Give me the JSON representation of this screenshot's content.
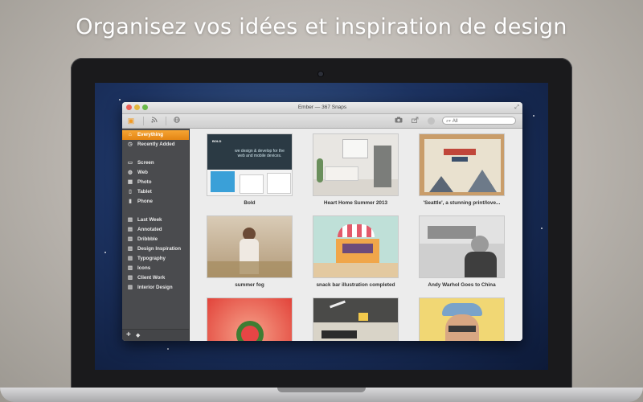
{
  "headline": "Organisez vos idées et inspiration de design",
  "window": {
    "title": "Ember — 367 Snaps"
  },
  "toolbar": {
    "search_placeholder": "All"
  },
  "sidebar": {
    "items": [
      {
        "label": "Everything",
        "icon": "home-icon",
        "active": true
      },
      {
        "label": "Recently Added",
        "icon": "clock-icon"
      },
      {
        "label": "Screen",
        "icon": "monitor-icon"
      },
      {
        "label": "Web",
        "icon": "globe-icon"
      },
      {
        "label": "Photo",
        "icon": "photo-icon"
      },
      {
        "label": "Tablet",
        "icon": "tablet-icon"
      },
      {
        "label": "Phone",
        "icon": "phone-icon"
      },
      {
        "label": "Last Week",
        "icon": "calendar-icon"
      },
      {
        "label": "Annotated",
        "icon": "annotation-icon"
      },
      {
        "label": "Dribbble",
        "icon": "document-icon"
      },
      {
        "label": "Design Inspiration",
        "icon": "document-icon"
      },
      {
        "label": "Typography",
        "icon": "document-icon"
      },
      {
        "label": "Icons",
        "icon": "document-icon"
      },
      {
        "label": "Client Work",
        "icon": "document-icon"
      },
      {
        "label": "Interior Design",
        "icon": "document-icon"
      }
    ]
  },
  "snaps": [
    {
      "caption": "Bold"
    },
    {
      "caption": "Heart Home Summer 2013"
    },
    {
      "caption": "'Seattle', a stunning print/love..."
    },
    {
      "caption": "summer fog"
    },
    {
      "caption": "snack bar illustration completed"
    },
    {
      "caption": "Andy Warhol Goes to China"
    },
    {
      "caption": ""
    },
    {
      "caption": ""
    },
    {
      "caption": ""
    }
  ],
  "bold_thumb": {
    "logo": "BOLD",
    "tagline": "we design & develop for the web and mobile devices."
  },
  "colors": {
    "accent": "#f29a22",
    "sidebar_bg": "#4a4b4e"
  }
}
